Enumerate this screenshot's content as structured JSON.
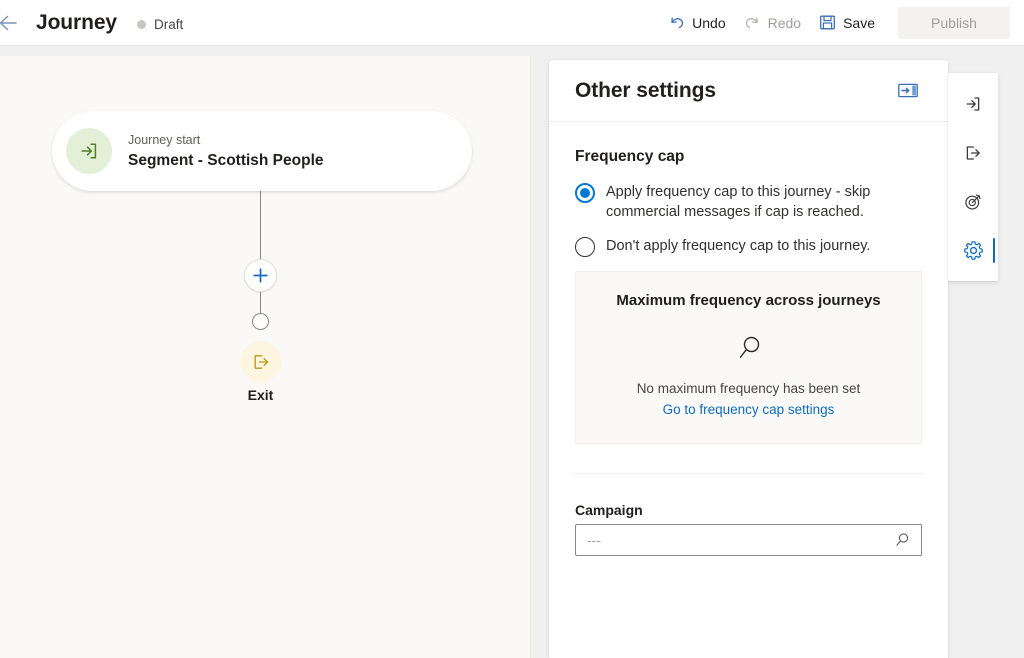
{
  "header": {
    "back_label": "Back",
    "title": "Journey",
    "status": "Draft",
    "undo_label": "Undo",
    "redo_label": "Redo",
    "save_label": "Save",
    "publish_label": "Publish"
  },
  "canvas": {
    "start_card": {
      "kicker": "Journey start",
      "name": "Segment - Scottish People"
    },
    "add_step_label": "+",
    "exit_label": "Exit"
  },
  "panel": {
    "title": "Other settings",
    "frequency_cap": {
      "section_title": "Frequency cap",
      "options": [
        {
          "label": "Apply frequency cap to this journey - skip commercial messages if cap is reached.",
          "selected": true
        },
        {
          "label": "Don't apply frequency cap to this journey.",
          "selected": false
        }
      ],
      "card": {
        "title": "Maximum frequency across journeys",
        "empty_text": "No maximum frequency has been set",
        "link_text": "Go to frequency cap settings"
      }
    },
    "campaign": {
      "label": "Campaign",
      "value": "",
      "placeholder": "---"
    }
  },
  "rail": {
    "items": [
      {
        "name": "entry-icon",
        "tooltip": "Journey start"
      },
      {
        "name": "exit-icon",
        "tooltip": "Exit"
      },
      {
        "name": "goal-icon",
        "tooltip": "Goal"
      },
      {
        "name": "settings-icon",
        "tooltip": "Other settings",
        "selected": true
      }
    ]
  },
  "colors": {
    "accent": "#0078d4",
    "link": "#0f6cbd",
    "start_icon_bg": "#e3efd6",
    "start_icon_fg": "#4f7f28",
    "exit_icon_bg": "#fdf5e0",
    "exit_icon_fg": "#b89a18",
    "canvas_bg": "#faf9f8"
  }
}
